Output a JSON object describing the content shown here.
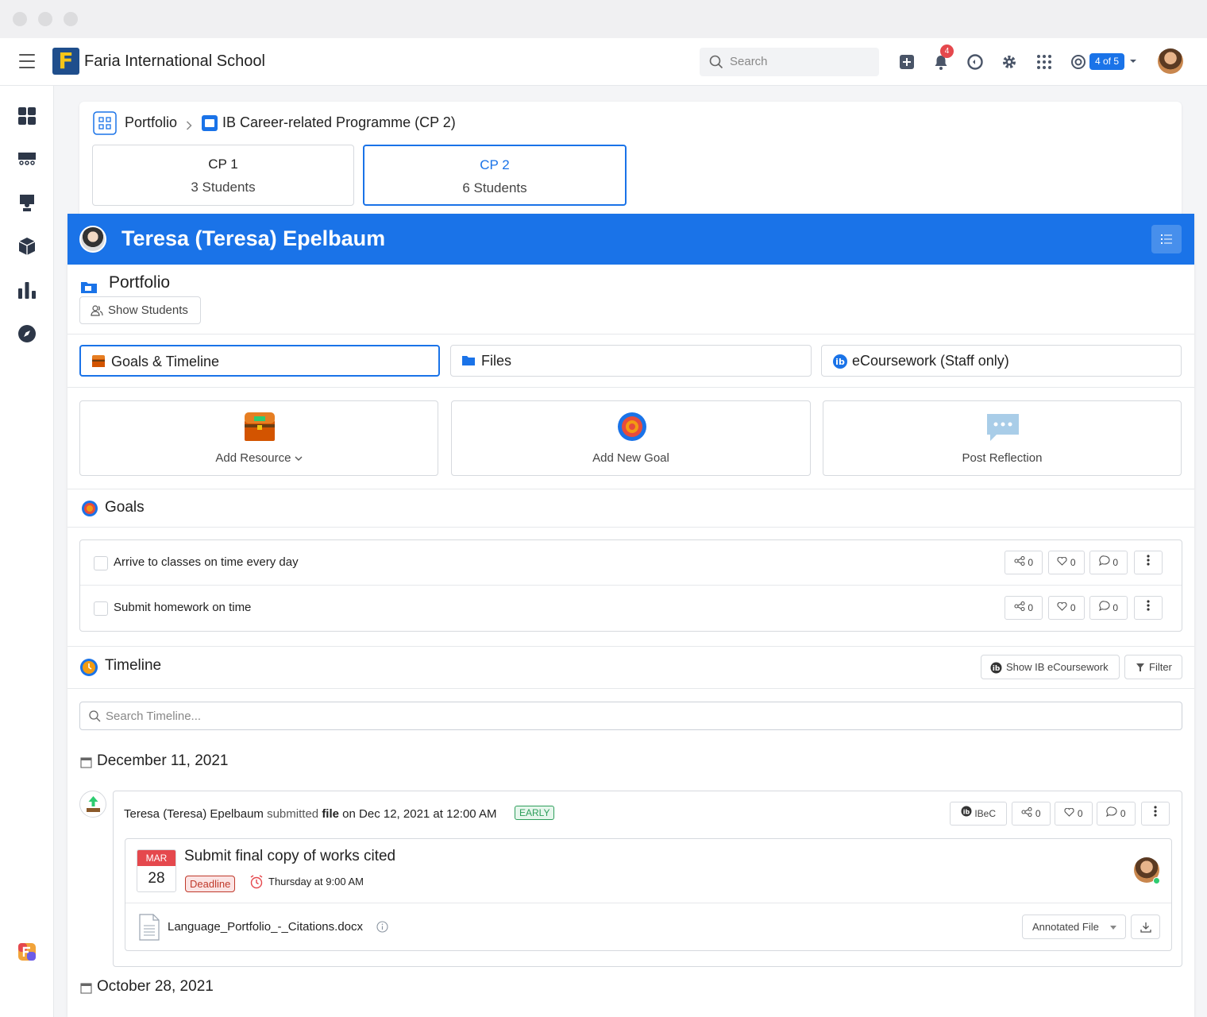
{
  "topbar": {
    "school_name": "Faria International School",
    "logo_letter": "F",
    "search_placeholder": "Search",
    "notification_count": "4",
    "pager": "4 of 5"
  },
  "breadcrumb": {
    "root": "Portfolio",
    "current": "IB Career-related Programme (CP 2)"
  },
  "cp_tabs": [
    {
      "label": "CP 1",
      "count": "3 Students"
    },
    {
      "label": "CP 2",
      "count": "6 Students"
    }
  ],
  "student": {
    "name": "Teresa (Teresa) Epelbaum"
  },
  "portfolio": {
    "title": "Portfolio",
    "show_students": "Show Students"
  },
  "tabs": [
    {
      "label": "Goals & Timeline"
    },
    {
      "label": "Files"
    },
    {
      "label": "eCoursework (Staff only)"
    }
  ],
  "actions": [
    {
      "label": "Add Resource"
    },
    {
      "label": "Add New Goal"
    },
    {
      "label": "Post Reflection"
    }
  ],
  "goals": {
    "title": "Goals",
    "items": [
      {
        "text": "Arrive to classes on time every day",
        "shares": "0",
        "likes": "0",
        "comments": "0"
      },
      {
        "text": "Submit homework on time",
        "shares": "0",
        "likes": "0",
        "comments": "0"
      }
    ]
  },
  "timeline": {
    "title": "Timeline",
    "show_ib": "Show IB eCoursework",
    "filter": "Filter",
    "search_placeholder": "Search Timeline...",
    "dates": [
      "December 11, 2021",
      "October 28, 2021"
    ],
    "entry": {
      "author": "Teresa (Teresa) Epelbaum",
      "verb": "submitted",
      "object": "file",
      "when": "on Dec 12, 2021 at 12:00 AM",
      "badge": "EARLY",
      "ibec": "IBeC",
      "shares": "0",
      "likes": "0",
      "comments": "0",
      "task_title": "Submit final copy of works cited",
      "cal_month": "MAR",
      "cal_day": "28",
      "deadline": "Deadline",
      "due_time": "Thursday at 9:00 AM",
      "file_name": "Language_Portfolio_-_Citations.docx",
      "file_type_select": "Annotated File"
    }
  },
  "colors": {
    "primary": "#1a73e8",
    "danger": "#e5484d",
    "success": "#2e9e5b"
  }
}
